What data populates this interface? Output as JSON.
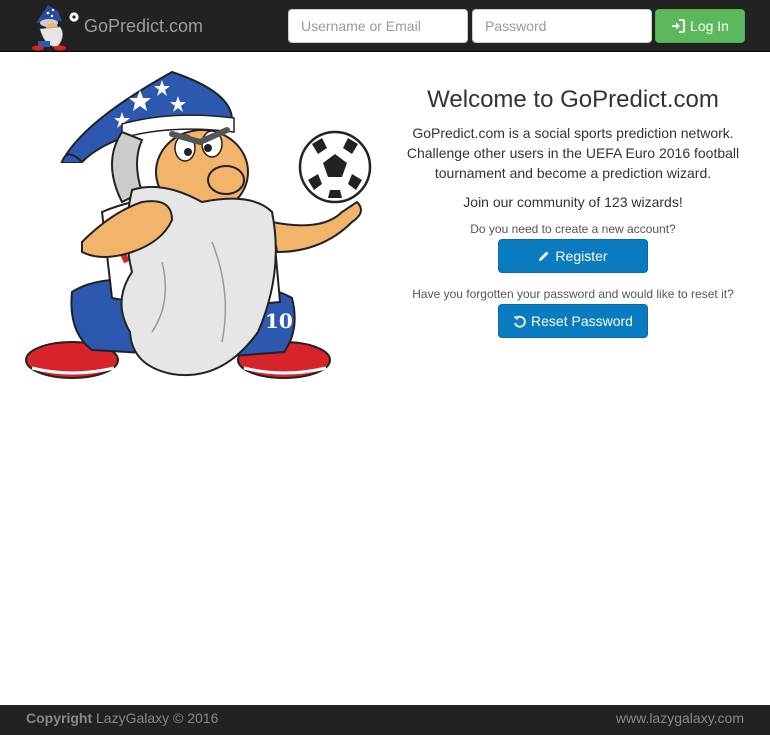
{
  "navbar": {
    "brand_name": "GoPredict.com",
    "username_placeholder": "Username or Email",
    "password_placeholder": "Password",
    "login_label": "Log In",
    "login_color": "#5cb85c"
  },
  "main": {
    "title": "Welcome to GoPredict.com",
    "description": "GoPredict.com is a social sports prediction network. Challenge other users in the UEFA Euro 2016 football tournament and become a prediction wizard.",
    "community": "Join our community of 123 wizards!",
    "register_prompt": "Do you need to create a new account?",
    "register_label": "Register",
    "reset_prompt": "Have you forgotten your password and would like to reset it?",
    "reset_label": "Reset Password",
    "primary_color": "#0b7bbf",
    "mascot_number": "10"
  },
  "footer": {
    "copyright_bold": "Copyright",
    "copyright_text": "LazyGalaxy © 2016",
    "site": "www.lazygalaxy.com"
  },
  "icons": {
    "login": "sign-in-icon",
    "register": "pencil-icon",
    "reset": "undo-icon"
  }
}
